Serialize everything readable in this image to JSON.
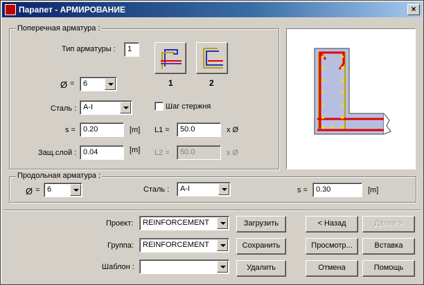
{
  "window": {
    "title": "Парапет - АРМИРОВАНИЕ",
    "close_glyph": "×"
  },
  "transverse": {
    "group_label": "Поперечная арматура :",
    "type_label": "Тип арматуры :",
    "type_value": "1",
    "type_option_1_label": "1",
    "type_option_2_label": "2",
    "diameter_symbol": "Ø",
    "diameter_eq": "=",
    "diameter_value": "6",
    "steel_label": "Сталь :",
    "steel_value": "A-I",
    "bar_spacing_checkbox_label": "Шаг стержня",
    "bar_spacing_checked": false,
    "s_label": "s =",
    "s_value": "0.20",
    "s_unit": "[m]",
    "l1_label": "L1 =",
    "l1_value": "50.0",
    "l1_unit": "x Ø",
    "cover_label": "Защ.слой :",
    "cover_value": "0.04",
    "cover_unit": "[m]",
    "l2_label": "L2 =",
    "l2_value": "50.0",
    "l2_unit": "x Ø"
  },
  "longitudinal": {
    "group_label": "Продольная арматура :",
    "diameter_symbol": "Ø",
    "diameter_eq": "=",
    "diameter_value": "6",
    "steel_label": "Сталь :",
    "steel_value": "A-I",
    "s_label": "s =",
    "s_value": "0.30",
    "s_unit": "[m]"
  },
  "template": {
    "project_label": "Проект:",
    "project_value": "REINFORCEMENT",
    "group_label": "Группа:",
    "group_value": "REINFORCEMENT",
    "template_label": "Шаблон :",
    "template_value": ""
  },
  "buttons": {
    "load": "Загрузить",
    "save": "Сохранить",
    "delete": "Удалить",
    "back": "< Назад",
    "next": "Далее >",
    "preview": "Просмотр...",
    "insert": "Вставка",
    "cancel": "Отмена",
    "help": "Помощь"
  },
  "colors": {
    "title_bar": "#0a246a",
    "rebar": "#e00000",
    "stirrup": "#c0a000",
    "dots": "#ffd700",
    "section": "#b7bfe0"
  }
}
